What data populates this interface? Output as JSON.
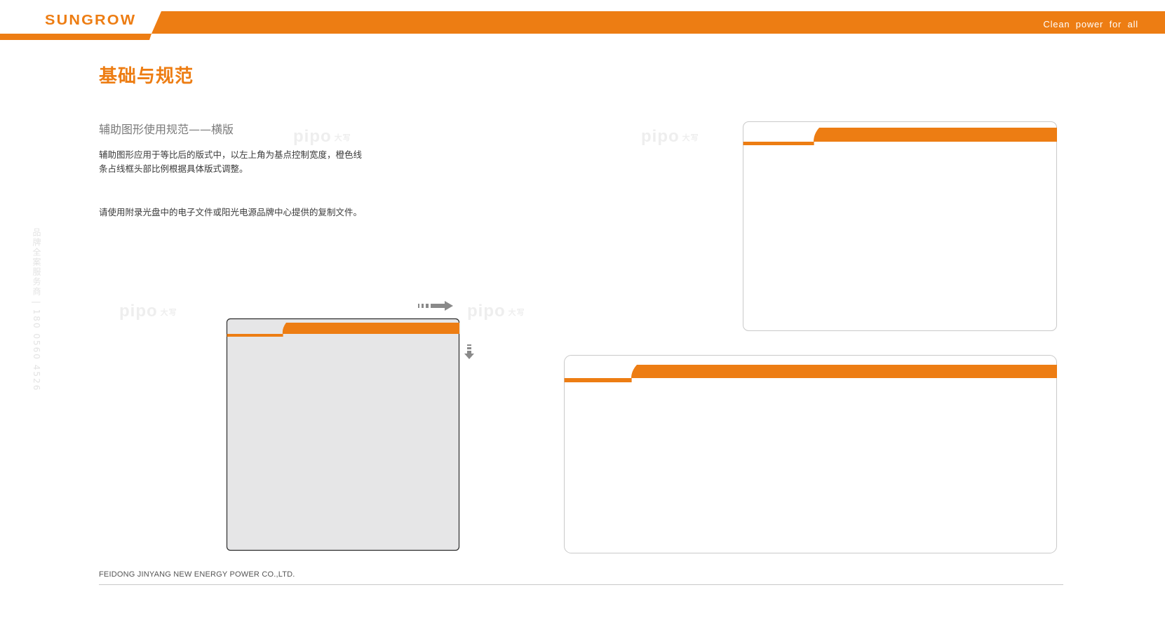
{
  "header": {
    "brand": "SUNGROW",
    "tagline": "Clean power for all",
    "accent_color": "#ed7d13"
  },
  "page": {
    "title": "基础与规范",
    "section_heading": "辅助图形使用规范——横版",
    "description_lines": [
      "辅助图形应用于等比后的版式中，以左上角为基点控制宽度，橙色线",
      "条占线框头部比例根据具体版式调整。"
    ],
    "note": "请使用附录光盘中的电子文件或阳光电源品牌中心提供的复制文件。"
  },
  "side_text": "品牌全案服务商 | 180 0560 4526",
  "watermark": {
    "text": "pipo",
    "sub": "大写"
  },
  "footer": {
    "company": "FEIDONG JINYANG NEW ENERGY POWER CO.,LTD."
  },
  "diagram": {
    "arrows": [
      "arrow-right-icon",
      "arrow-down-icon"
    ],
    "frames": [
      "frame-square-gray",
      "frame-wide-top",
      "frame-wide-bottom"
    ],
    "frame_fill_gray": "#e6e6e7",
    "frame_stroke": "#c9c9c9"
  }
}
